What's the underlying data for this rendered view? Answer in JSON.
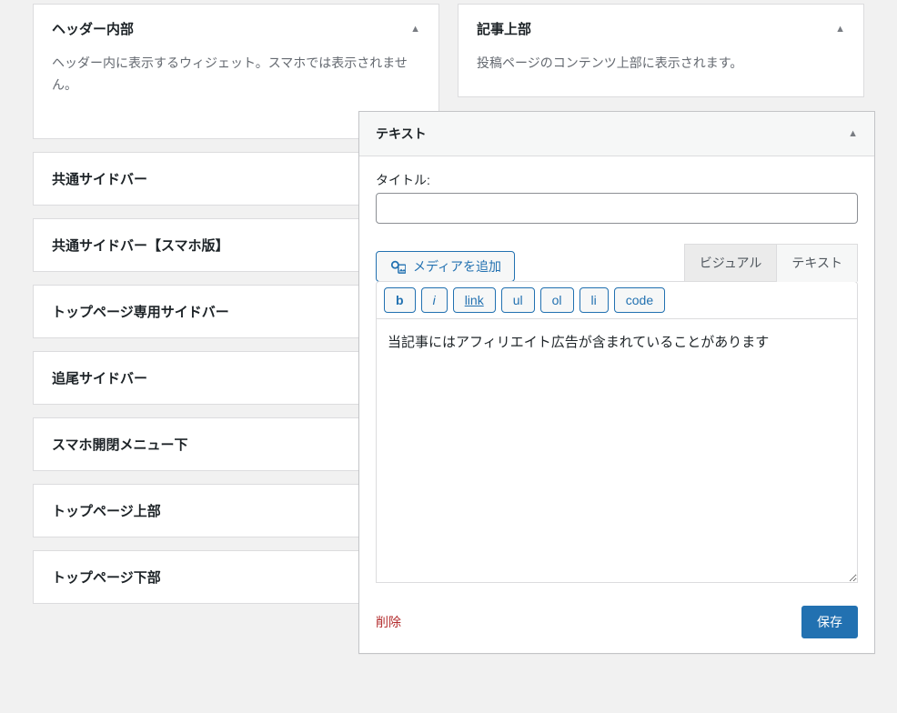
{
  "left_areas": [
    {
      "title": "ヘッダー内部",
      "desc": "ヘッダー内に表示するウィジェット。スマホでは表示されません。",
      "expanded": true
    },
    {
      "title": "共通サイドバー",
      "expanded": false
    },
    {
      "title": "共通サイドバー【スマホ版】",
      "expanded": false
    },
    {
      "title": "トップページ専用サイドバー",
      "expanded": false
    },
    {
      "title": "追尾サイドバー",
      "expanded": false
    },
    {
      "title": "スマホ開閉メニュー下",
      "expanded": false
    },
    {
      "title": "トップページ上部",
      "expanded": false
    },
    {
      "title": "トップページ下部",
      "expanded": false
    }
  ],
  "right_area": {
    "title": "記事上部",
    "desc": "投稿ページのコンテンツ上部に表示されます。"
  },
  "text_widget": {
    "header": "テキスト",
    "title_label": "タイトル:",
    "title_value": "",
    "media_button": "メディアを追加",
    "tabs": {
      "visual": "ビジュアル",
      "text": "テキスト"
    },
    "toolbar": {
      "b": "b",
      "i": "i",
      "link": "link",
      "ul": "ul",
      "ol": "ol",
      "li": "li",
      "code": "code"
    },
    "content": "当記事にはアフィリエイト広告が含まれていることがあります",
    "delete": "削除",
    "save": "保存"
  }
}
